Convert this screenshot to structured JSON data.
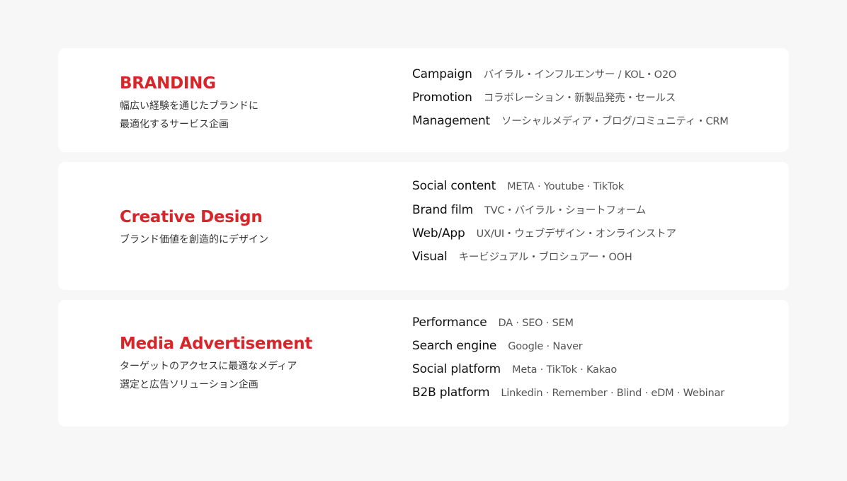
{
  "accent_color": "#d7262a",
  "cards": [
    {
      "title": "BRANDING",
      "desc_lines": [
        "幅広い経験を通じたブランドに",
        "最適化するサービス企画"
      ],
      "services": [
        {
          "name": "Campaign",
          "detail": "バイラル・インフルエンサー / KOL・O2O"
        },
        {
          "name": "Promotion",
          "detail": "コラボレーション・新製品発売・セールス"
        },
        {
          "name": "Management",
          "detail": "ソーシャルメディア・ブログ/コミュニティ・CRM"
        }
      ]
    },
    {
      "title": "Creative Design",
      "desc_lines": [
        "ブランド価値を創造的にデザイン"
      ],
      "services": [
        {
          "name": "Social content",
          "detail": "META · Youtube · TikTok"
        },
        {
          "name": "Brand film",
          "detail": "TVC・バイラル・ショートフォーム"
        },
        {
          "name": "Web/App",
          "detail": "UX/UI・ウェブデザイン・オンラインストア"
        },
        {
          "name": "Visual",
          "detail": "キービジュアル・ブロシュアー・OOH"
        }
      ]
    },
    {
      "title": "Media Advertisement",
      "desc_lines": [
        "ターゲットのアクセスに最適なメディア",
        "選定と広告ソリューション企画"
      ],
      "services": [
        {
          "name": "Performance",
          "detail": "DA · SEO · SEM"
        },
        {
          "name": "Search engine",
          "detail": "Google · Naver"
        },
        {
          "name": "Social platform",
          "detail": "Meta · TikTok · Kakao"
        },
        {
          "name": "B2B platform",
          "detail": "Linkedin · Remember · Blind · eDM · Webinar"
        }
      ]
    }
  ]
}
